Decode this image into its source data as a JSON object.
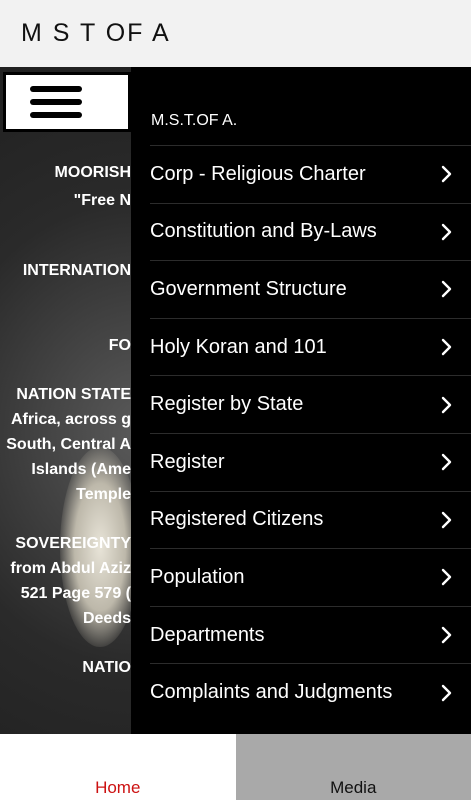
{
  "app": {
    "title": "M S T OF A"
  },
  "background": {
    "lines": [
      "MOORISH",
      "\"Free N",
      "INTERNATION",
      "FO",
      "NATION STATE",
      "Africa, across g",
      "South, Central A",
      "Islands (Ame",
      "Temple",
      "SOVEREIGNTY",
      "from Abdul Aziz",
      "521 Page 579 (",
      "Deeds",
      "NATIO"
    ]
  },
  "drawer": {
    "title": "M.S.T.OF A.",
    "items": [
      {
        "label": "Corp - Religious Charter",
        "icon": "chevron-right-icon"
      },
      {
        "label": "Constitution and By-Laws",
        "icon": "chevron-right-icon"
      },
      {
        "label": "Government Structure",
        "icon": "chevron-right-icon"
      },
      {
        "label": "Holy Koran and 101",
        "icon": "chevron-right-icon"
      },
      {
        "label": "Register by State",
        "icon": "chevron-right-icon"
      },
      {
        "label": "Register",
        "icon": "chevron-right-icon"
      },
      {
        "label": "Registered Citizens",
        "icon": "chevron-right-icon"
      },
      {
        "label": "Population",
        "icon": "chevron-right-icon"
      },
      {
        "label": "Departments",
        "icon": "chevron-right-icon"
      },
      {
        "label": "Complaints and Judgments",
        "icon": "chevron-right-icon"
      }
    ]
  },
  "bottom_nav": {
    "tabs": [
      {
        "label": "Home",
        "active": true
      },
      {
        "label": "Media",
        "active": false
      }
    ]
  },
  "colors": {
    "active_tab_text": "#cc1111",
    "inactive_tab_bg": "#a9a9a9",
    "drawer_bg": "#000000"
  }
}
